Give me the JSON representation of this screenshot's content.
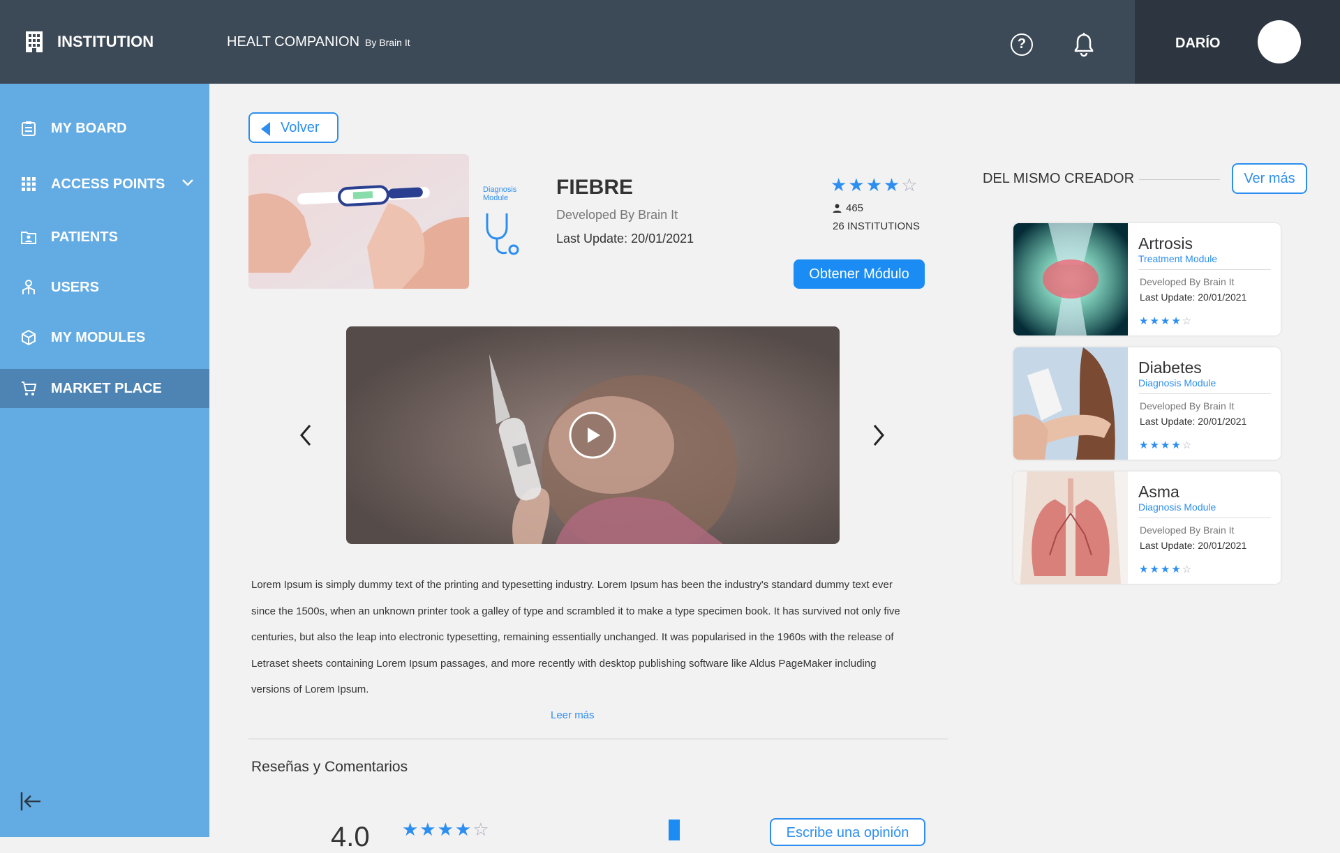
{
  "header": {
    "institution_label": "INSTITUTION",
    "app_name": "HEALT COMPANION",
    "app_by": "By Brain It",
    "user_name": "DARÍO",
    "icons": [
      "building-icon",
      "help-icon",
      "bell-icon"
    ]
  },
  "sidebar": {
    "items": [
      {
        "label": "MY BOARD",
        "icon": "clipboard-icon"
      },
      {
        "label": "ACCESS POINTS",
        "icon": "grid-icon"
      },
      {
        "label": "PATIENTS",
        "icon": "folder-user-icon"
      },
      {
        "label": "USERS",
        "icon": "users-icon"
      },
      {
        "label": "MY MODULES",
        "icon": "cube-icon"
      },
      {
        "label": "MARKET PLACE",
        "icon": "cart-icon",
        "active": true
      }
    ]
  },
  "module": {
    "back_label": "Volver",
    "type_label": "Diagnosis Module",
    "title": "FIEBRE",
    "developer": "Developed By Brain It",
    "last_update": "Last Update: 20/01/2021",
    "rating_stars": 4,
    "users_count": "465",
    "institutions": "26 INSTITUTIONS",
    "obtain_label": "Obtener Módulo",
    "description": "Lorem Ipsum is simply dummy text of the printing and typesetting industry. Lorem Ipsum has been the industry's standard dummy text ever since the 1500s, when an unknown printer took a galley of type and scrambled it to make a type specimen book. It has survived not only five centuries, but also the leap into electronic typesetting, remaining essentially unchanged. It was popularised in the 1960s with the release of Letraset sheets containing Lorem Ipsum passages, and more recently with desktop publishing software like Aldus PageMaker including versions of Lorem Ipsum.",
    "read_more": "Leer más"
  },
  "reviews": {
    "title": "Reseñas y Comentarios",
    "average": "4.0",
    "write_label": "Escribe una opinión"
  },
  "related": {
    "title": "DEL MISMO CREADOR",
    "see_more": "Ver más",
    "cards": [
      {
        "title": "Artrosis",
        "type": "Treatment Module",
        "developer": "Developed By Brain It",
        "last_update": "Last Update: 20/01/2021",
        "stars": 4
      },
      {
        "title": "Diabetes",
        "type": "Diagnosis Module",
        "developer": "Developed By Brain It",
        "last_update": "Last Update: 20/01/2021",
        "stars": 4
      },
      {
        "title": "Asma",
        "type": "Diagnosis Module",
        "developer": "Developed By Brain It",
        "last_update": "Last Update: 20/01/2021",
        "stars": 4
      }
    ]
  },
  "colors": {
    "accent": "#1a8cf4",
    "sidebar": "#63abe3",
    "topbar": "#3c4956"
  }
}
